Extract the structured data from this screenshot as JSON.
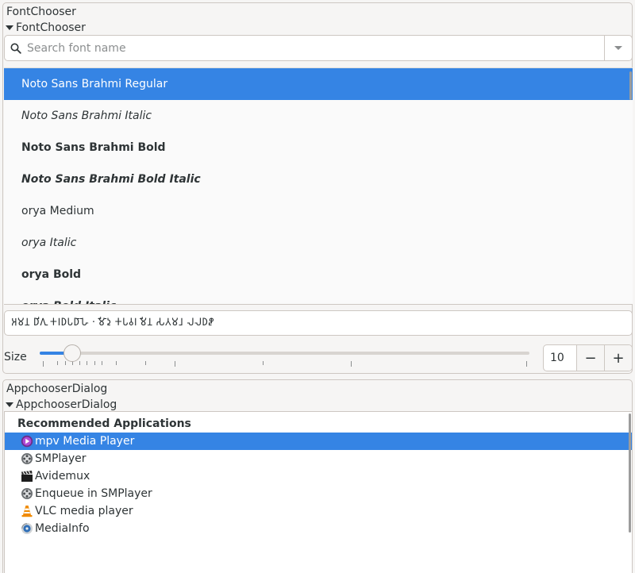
{
  "font_chooser": {
    "frame_title": "FontChooser",
    "expander_label": "FontChooser",
    "search": {
      "placeholder": "Search font name",
      "value": ""
    },
    "fonts": [
      {
        "name": "Noto Sans Brahmi Regular",
        "style": "normal",
        "weight": "normal",
        "selected": true
      },
      {
        "name": "Noto Sans Brahmi Italic",
        "style": "italic",
        "weight": "normal",
        "selected": false
      },
      {
        "name": "Noto Sans Brahmi Bold",
        "style": "normal",
        "weight": "bold",
        "selected": false
      },
      {
        "name": "Noto Sans Brahmi Bold Italic",
        "style": "italic",
        "weight": "bold",
        "selected": false
      },
      {
        "name": "orya Medium",
        "style": "normal",
        "weight": "normal",
        "selected": false
      },
      {
        "name": "orya Italic",
        "style": "italic",
        "weight": "normal",
        "selected": false
      },
      {
        "name": "orya Bold",
        "style": "normal",
        "weight": "bold",
        "selected": false
      },
      {
        "name": "orya Bold Italic",
        "style": "italic",
        "weight": "bold",
        "selected": false
      }
    ],
    "preview_text": "𑀅𑀫𑀦 𑀥𑀺𑀕𑀼 𑀓𑀭𑀥𑀧𑀥𑀸𑀳𑁂 · 𑀺𑀫𑀸𑀤𑀼 𑀓𑀧𑀯𑀭 𑀺𑀫𑀦 𑀲𑀢𑀫𑀭𑀾 𑀮𑀮𑀥𑀵𑀼",
    "size_label": "Size",
    "size_value": "10",
    "size_slider": {
      "min": 6,
      "max": 72,
      "value": 10,
      "ticks": [
        6,
        8,
        9,
        10,
        11,
        12,
        13,
        14,
        16,
        20,
        24,
        36,
        48,
        72
      ]
    }
  },
  "app_chooser": {
    "frame_title": "AppchooserDialog",
    "expander_label": "AppchooserDialog",
    "section_title": "Recommended Applications",
    "apps": [
      {
        "name": "mpv Media Player",
        "icon": "mpv-icon",
        "selected": true
      },
      {
        "name": "SMPlayer",
        "icon": "smplayer-icon",
        "selected": false
      },
      {
        "name": "Avidemux",
        "icon": "clapperboard-icon",
        "selected": false
      },
      {
        "name": "Enqueue in SMPlayer",
        "icon": "smplayer-icon",
        "selected": false
      },
      {
        "name": "VLC media player",
        "icon": "vlc-cone-icon",
        "selected": false
      },
      {
        "name": "MediaInfo",
        "icon": "mediainfo-icon",
        "selected": false
      }
    ]
  },
  "colors": {
    "accent": "#3584e4",
    "window_bg": "#f6f5f4",
    "border": "#cdc7c2",
    "text": "#2e3436"
  }
}
